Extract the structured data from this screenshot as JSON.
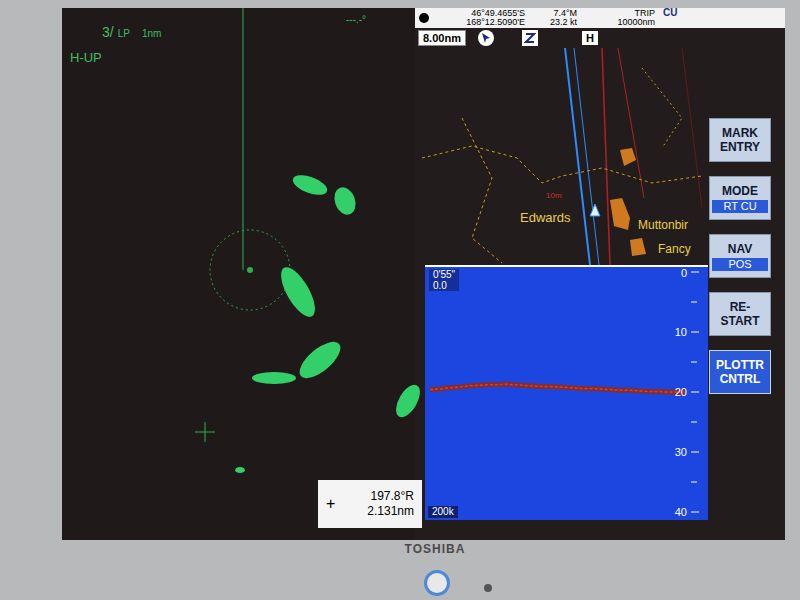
{
  "monitor": {
    "brand": "TOSHIBA"
  },
  "radar": {
    "range_index": "3/",
    "mode": "LP",
    "range": "1nm",
    "orientation": "H-UP",
    "heading": "---.-°",
    "cursor": {
      "symbol": "+",
      "bearing": "197.8°R",
      "distance": "2.131nm"
    }
  },
  "header": {
    "latitude": "46°49.4655'S",
    "longitude": "168°12.5090'E",
    "course": "7.4°M",
    "speed": "23.2 kt",
    "trip_label": "TRIP",
    "trip": "10000nm",
    "mode": "CU"
  },
  "toolbar": {
    "range": "8.00nm",
    "home": "H"
  },
  "chart": {
    "labels": [
      {
        "text": "Edwards",
        "color": "#e8d048"
      },
      {
        "text": "Muttonbir",
        "color": "#e8d048"
      },
      {
        "text": "Fancy",
        "color": "#e8d048"
      },
      {
        "text": "10m",
        "color": "#d03030"
      }
    ]
  },
  "buttons": [
    {
      "label": "MARK ENTRY",
      "value": null,
      "selected": false
    },
    {
      "label": "MODE",
      "value": "RT CU",
      "selected": false
    },
    {
      "label": "NAV",
      "value": "POS",
      "selected": false
    },
    {
      "label": "RE-START",
      "value": null,
      "selected": false
    },
    {
      "label": "PLOTTR CNTRL",
      "value": null,
      "selected": true
    }
  ],
  "sounder": {
    "time": "0'55\"",
    "depth": "0.0",
    "scale": [
      "0",
      "10",
      "20",
      "30",
      "40"
    ],
    "frequency": "200k",
    "bottom_depth": [
      19.6,
      19.5,
      19.3,
      19.2,
      19.0,
      18.9,
      18.8,
      18.8,
      18.7,
      18.8,
      18.9,
      19.0,
      19.1,
      19.1,
      19.2,
      19.3,
      19.4,
      19.4,
      19.5,
      19.6,
      19.7,
      19.7,
      19.8,
      19.9,
      19.9,
      20.0,
      20.0,
      20.1
    ]
  }
}
